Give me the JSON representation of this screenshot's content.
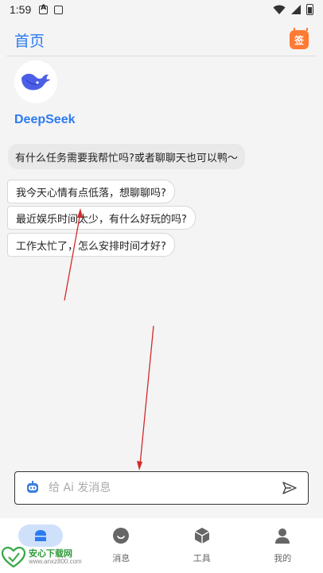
{
  "status_bar": {
    "time": "1:59"
  },
  "header": {
    "title": "首页",
    "sign_label": "签"
  },
  "bot": {
    "name": "DeepSeek",
    "greeting": "有什么任务需要我帮忙吗?或者聊聊天也可以鸭～"
  },
  "suggestions": [
    "我今天心情有点低落，想聊聊吗?",
    "最近娱乐时间太少，有什么好玩的吗?",
    "工作太忙了，怎么安排时间才好?"
  ],
  "input": {
    "placeholder": "给 Ai 发消息",
    "value": ""
  },
  "nav": {
    "items": [
      {
        "label": "",
        "icon": "home-icon"
      },
      {
        "label": "消息",
        "icon": "message-icon"
      },
      {
        "label": "工具",
        "icon": "tool-cube-icon"
      },
      {
        "label": "我的",
        "icon": "user-icon"
      }
    ],
    "active_index": 0
  },
  "watermark": {
    "title": "安心下载网",
    "url": "www.anxz800.com"
  },
  "colors": {
    "accent": "#2d7bf0",
    "sign_badge": "#ff7a33",
    "annotation_arrow": "#d42a2a",
    "nav_active_bg": "#cfe0fb"
  }
}
